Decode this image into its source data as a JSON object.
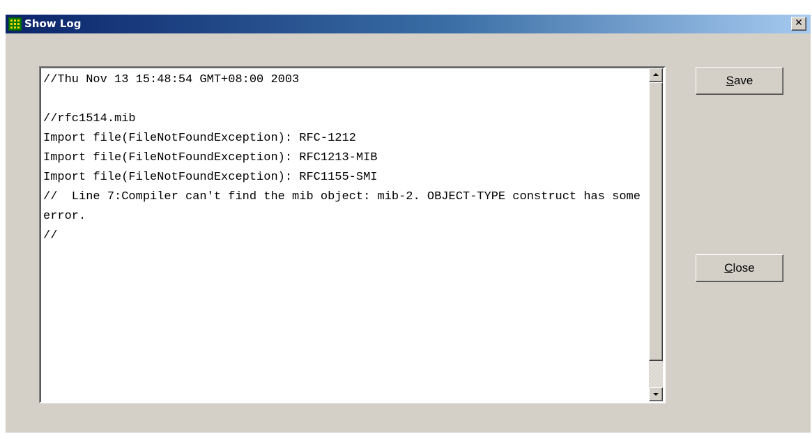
{
  "window": {
    "title": "Show Log",
    "close_glyph": "✕"
  },
  "icons": {
    "app": "grid-app-icon",
    "close": "close-icon",
    "scroll_up": "up-arrow-icon",
    "scroll_down": "down-arrow-icon"
  },
  "log": {
    "content": "//Thu Nov 13 15:48:54 GMT+08:00 2003\n\n//rfc1514.mib\nImport file(FileNotFoundException): RFC-1212\nImport file(FileNotFoundException): RFC1213-MIB\nImport file(FileNotFoundException): RFC1155-SMI\n//  Line 7:Compiler can't find the mib object: mib-2. OBJECT-TYPE construct has some error.\n//"
  },
  "buttons": {
    "save": {
      "label": "Save",
      "mnemonic": "S",
      "rest": "ave"
    },
    "close": {
      "label": "Close",
      "mnemonic": "C",
      "rest": "lose"
    }
  },
  "colors": {
    "title_start": "#0a246a",
    "title_end": "#a6caf0",
    "face": "#d4d0c8"
  }
}
